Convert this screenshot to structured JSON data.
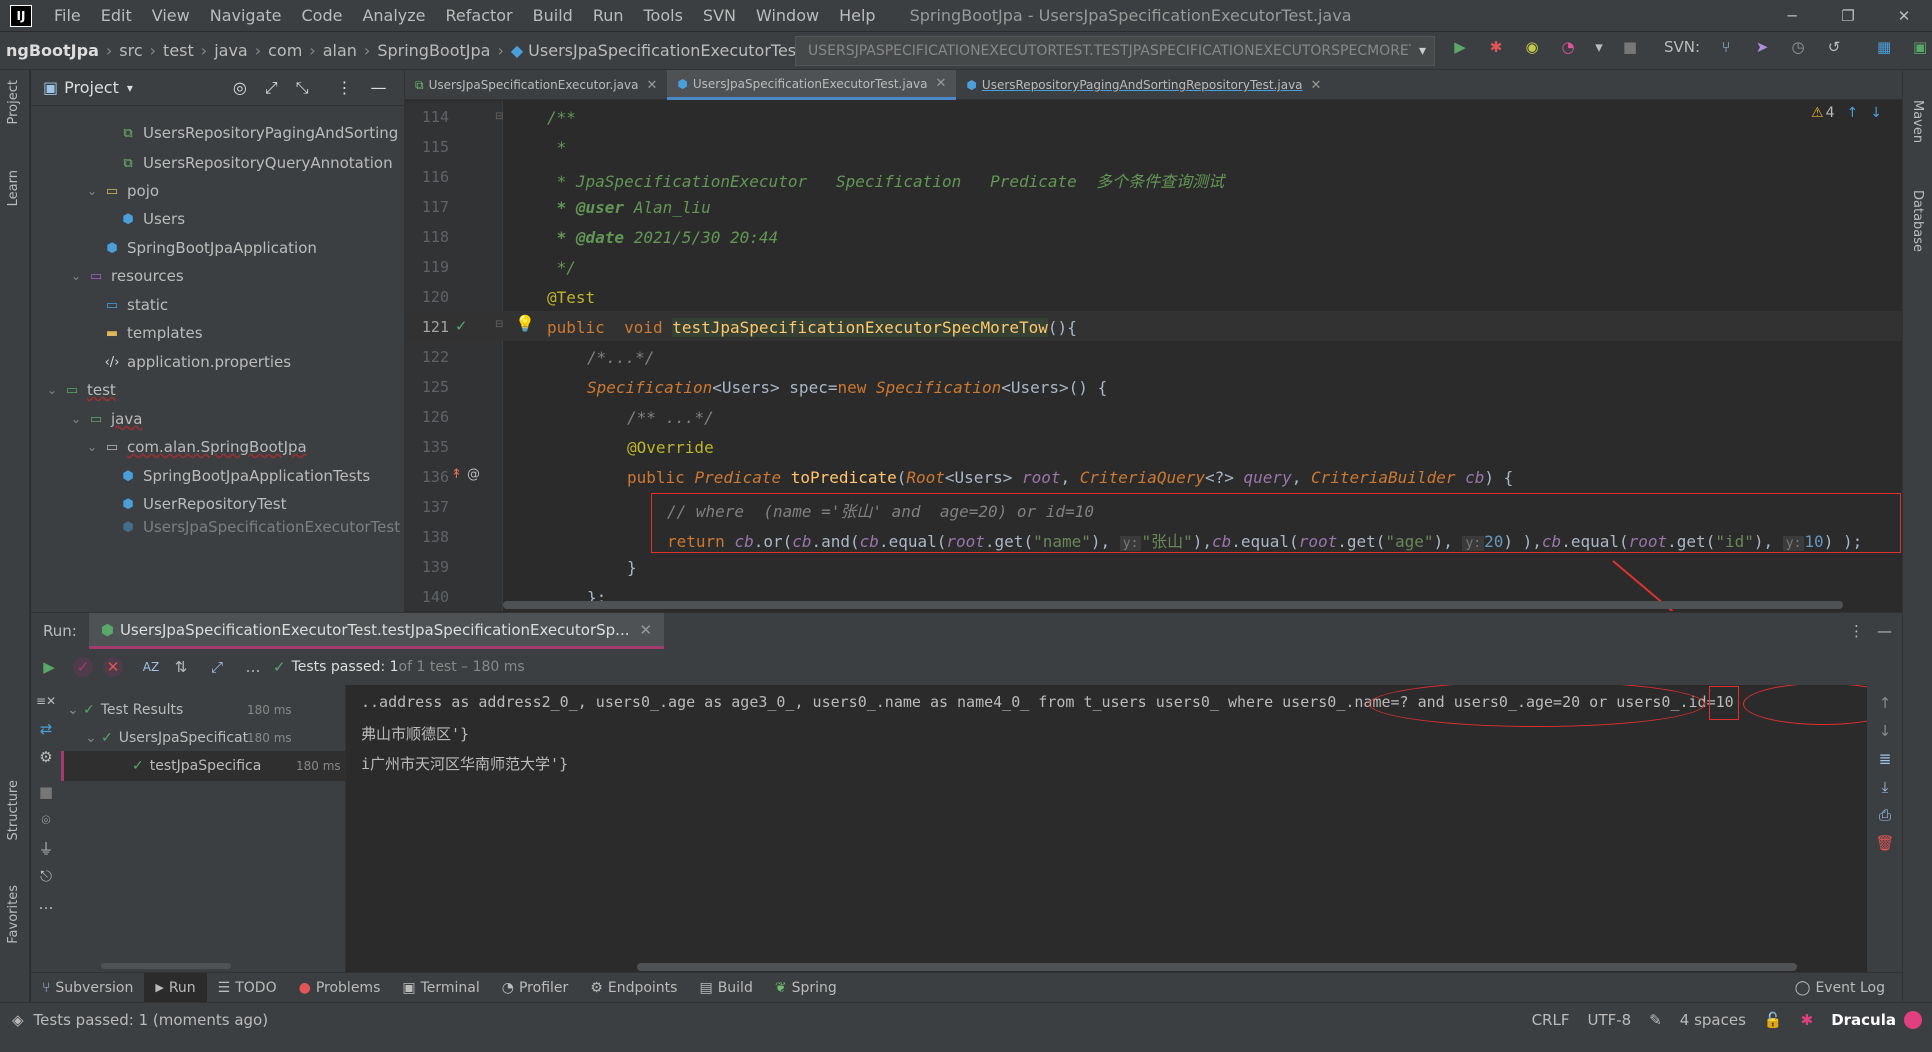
{
  "window": {
    "title": "SpringBootJpa - UsersJpaSpecificationExecutorTest.java",
    "menu": [
      "File",
      "Edit",
      "View",
      "Navigate",
      "Code",
      "Analyze",
      "Refactor",
      "Build",
      "Run",
      "Tools",
      "SVN",
      "Window",
      "Help"
    ]
  },
  "breadcrumbs": [
    "ngBootJpa",
    "src",
    "test",
    "java",
    "com",
    "alan",
    "SpringBootJpa",
    "UsersJpaSpecificationExecutorTest"
  ],
  "run_config": "USERSJPASPECIFICATIONEXECUTORTEST.TESTJPASPECIFICATIONEXECUTORSPECMORETOW",
  "svn_label": "SVN:",
  "project": {
    "title": "Project",
    "rows": [
      {
        "label": "UsersRepositoryPagingAndSorting",
        "type": "interface"
      },
      {
        "label": "UsersRepositoryQueryAnnotation",
        "type": "interface"
      },
      {
        "label": "pojo",
        "type": "folder"
      },
      {
        "label": "Users",
        "type": "class"
      },
      {
        "label": "SpringBootJpaApplication",
        "type": "spring"
      },
      {
        "label": "resources",
        "type": "resfolder"
      },
      {
        "label": "static",
        "type": "webfolder"
      },
      {
        "label": "templates",
        "type": "folder"
      },
      {
        "label": "application.properties",
        "type": "props"
      },
      {
        "label": "test",
        "type": "testfolder"
      },
      {
        "label": "java",
        "type": "testfolder"
      },
      {
        "label": "com.alan.SpringBootJpa",
        "type": "package"
      },
      {
        "label": "SpringBootJpaApplicationTests",
        "type": "spring"
      },
      {
        "label": "UserRepositoryTest",
        "type": "spring"
      },
      {
        "label": "UsersJpaSpecificationExecutorTest",
        "type": "spring"
      }
    ]
  },
  "tabs": [
    {
      "label": "UsersJpaSpecificationExecutor.java",
      "active": false
    },
    {
      "label": "UsersJpaSpecificationExecutorTest.java",
      "active": true
    },
    {
      "label": "UsersRepositoryPagingAndSortingRepositoryTest.java",
      "active": false
    }
  ],
  "editor": {
    "warnings": "4",
    "line_numbers": [
      "114",
      "115",
      "116",
      "117",
      "118",
      "119",
      "120",
      "121",
      "122",
      "125",
      "126",
      "135",
      "136",
      "137",
      "138",
      "139",
      "140"
    ],
    "code": {
      "l114": "/**",
      "l115": " *",
      "l116": " * JpaSpecificationExecutor   Specification   Predicate  多个条件查询测试",
      "l117a": " * @user",
      "l117b": " Alan_liu",
      "l118a": " * @date",
      "l118b": " 2021/5/30 20:44",
      "l119": " */",
      "l120": "@Test",
      "l121a": "public  void ",
      "l121b": "testJpaSpecificationExecutorSpecMoreTow",
      "l121c": "(){",
      "l122": "/*...*/",
      "l125a": "Specification",
      "l125b": "<Users> spec=",
      "l125c": "new ",
      "l125d": "Specification",
      "l125e": "<Users>() {",
      "l126": "/** ...*/",
      "l135": "@Override",
      "l136a": "public ",
      "l136b": "Predicate ",
      "l136c": "toPredicate",
      "l136d": "(",
      "l136e": "Root",
      "l136f": "<Users> ",
      "l136g": "root",
      "l136h": ", ",
      "l136i": "CriteriaQuery",
      "l136j": "<?> ",
      "l136k": "query",
      "l136l": ", ",
      "l136m": "CriteriaBuilder ",
      "l136n": "cb",
      "l136o": ") {",
      "l137": "// where  (name ='张山' and  age=20) or id=10",
      "l138_return": "return ",
      "l138_cb1": "cb",
      "l138_or": ".or(",
      "l138_cb2": "cb",
      "l138_and": ".and(",
      "l138_cb3": "cb",
      "l138_eq1": ".equal(",
      "l138_root1": "root",
      "l138_get1": ".get(",
      "l138_s1": "\"name\"",
      "l138_c1": "), ",
      "l138_h1": "y:",
      "l138_s2": "\"张山\"",
      "l138_c2": "),",
      "l138_cb4": "cb",
      "l138_eq2": ".equal(",
      "l138_root2": "root",
      "l138_get2": ".get(",
      "l138_s3": "\"age\"",
      "l138_c3": "), ",
      "l138_h2": "y:",
      "l138_n1": "20",
      "l138_c4": ") ),",
      "l138_cb5": "cb",
      "l138_eq3": ".equal(",
      "l138_root3": "root",
      "l138_get3": ".get(",
      "l138_s4": "\"id\"",
      "l138_c5": "), ",
      "l138_h3": "y:",
      "l138_n2": "10",
      "l138_c6": ") );",
      "l139": "}",
      "l140": "};"
    }
  },
  "run": {
    "label": "Run:",
    "tab": "UsersJpaSpecificationExecutorTest.testJpaSpecificationExecutorSp...",
    "tests_passed": "Tests passed: 1",
    "tests_of": " of 1 test – 180 ms",
    "tree": [
      {
        "label": "Test Results",
        "time": "180 ms"
      },
      {
        "label": "UsersJpaSpecificat",
        "time": "180 ms"
      },
      {
        "label": "testJpaSpecifica",
        "time": "180 ms"
      }
    ],
    "console": [
      "..address as address2_0_, users0_.age as age3_0_, users0_.name as name4_0_ from t_users users0_ where users0_.name=? and users0_.age=20 or users0_.id=10",
      "弗山市顺德区'}",
      "i广州市天河区华南师范大学'}"
    ]
  },
  "bottom_tools": [
    "Subversion",
    "Run",
    "TODO",
    "Problems",
    "Terminal",
    "Profiler",
    "Endpoints",
    "Build",
    "Spring"
  ],
  "event_log": "Event Log",
  "status": {
    "message": "Tests passed: 1 (moments ago)",
    "line_sep": "CRLF",
    "encoding": "UTF-8",
    "indent": "4 spaces",
    "theme": "Dracula"
  },
  "side_labels": {
    "project": "Project",
    "learn": "Learn",
    "structure": "Structure",
    "favorites": "Favorites",
    "maven": "Maven",
    "database": "Database"
  },
  "colors": {
    "accent": "#4a88c7",
    "annotation_red": "#e03030",
    "pass_green": "#5fb85f"
  }
}
